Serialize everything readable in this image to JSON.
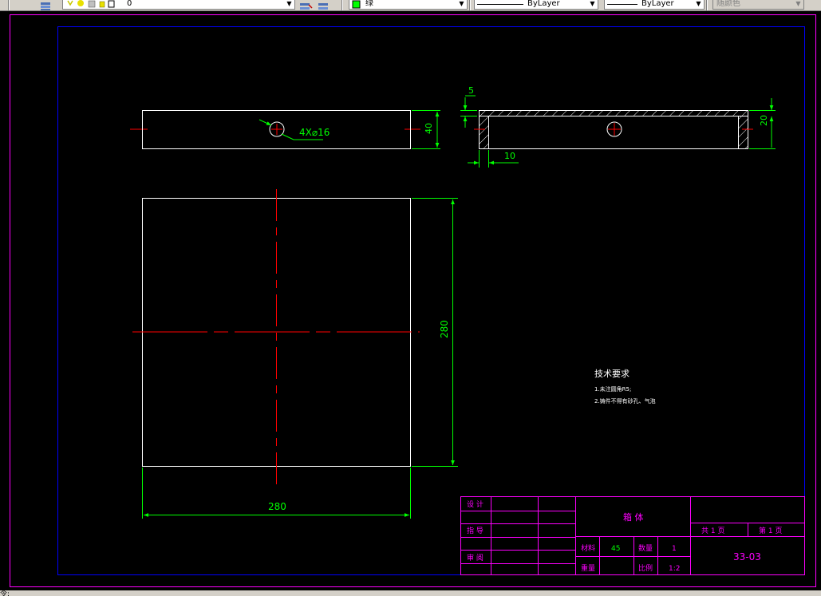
{
  "toolbar": {
    "layer_value": "0",
    "color_value": "绿",
    "linetype_value": "ByLayer",
    "lineweight_value": "ByLayer",
    "plotstyle_value": "随颜色"
  },
  "colors": {
    "green": "#00ff00",
    "white": "#ffffff",
    "red": "#ff0000",
    "magenta": "#ff00ff",
    "blue": "#0000ff",
    "background": "#000000"
  },
  "drawing": {
    "top_view_height_dim": "40",
    "hole_callout": "4X⌀16",
    "section_thickness_dim": "5",
    "section_wall_dim": "10",
    "section_height_dim": "20",
    "plan_height_dim": "280",
    "plan_width_dim": "280",
    "tech_title": "技术要求",
    "tech_item_1": "1.未注圆角R5;",
    "tech_item_2": "2.铸件不得有砂孔、气泡"
  },
  "title_block": {
    "design": "设 计",
    "guide": "指 导",
    "review": "审 阅",
    "part_name": "箱 体",
    "total_pages": "共  1  页",
    "page_number": "第  1  页",
    "material_label": "材料",
    "material_value": "45",
    "quantity_label": "数量",
    "quantity_value": "1",
    "weight_label": "重量",
    "scale_label": "比例",
    "scale_value": "1:2",
    "drawing_number": "33-03"
  },
  "status": {
    "command_prefix": "令:"
  }
}
